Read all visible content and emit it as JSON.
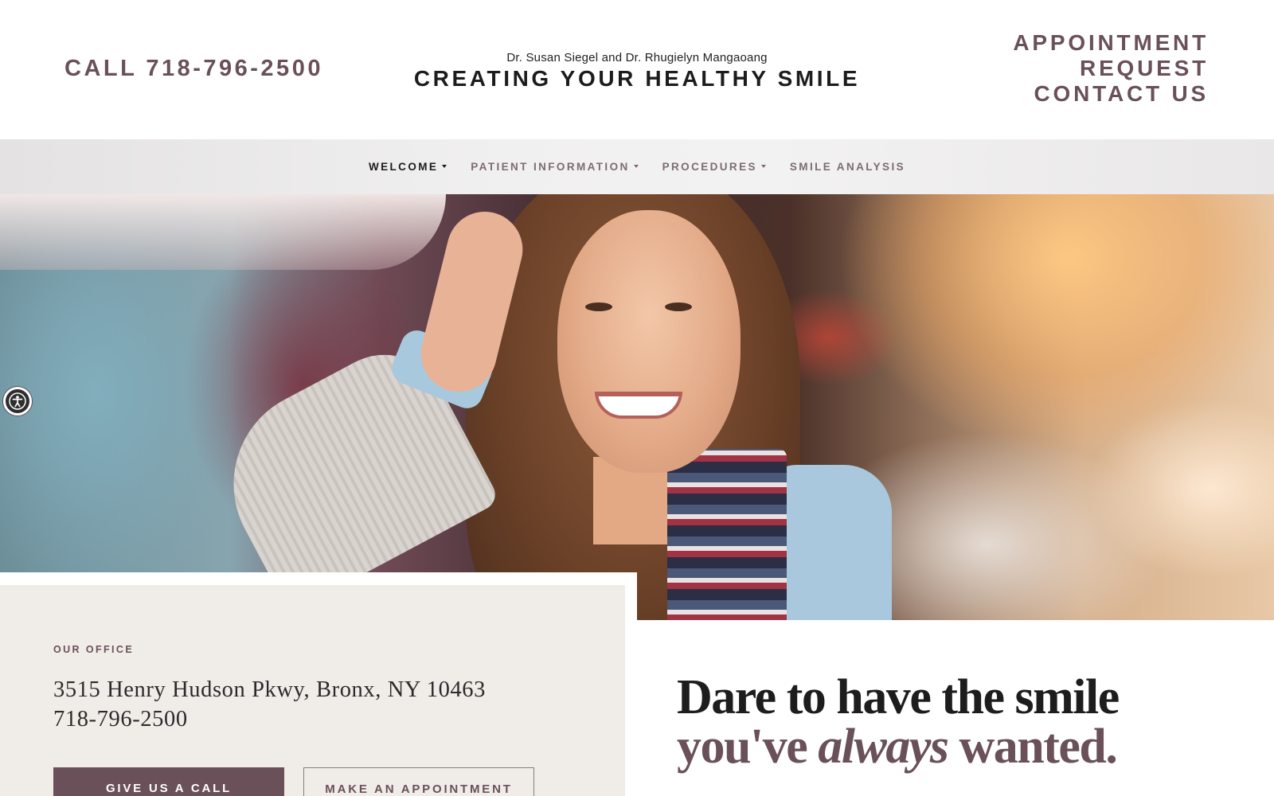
{
  "header": {
    "call_text": "CALL 718-796-2500",
    "doctors": "Dr. Susan Siegel and Dr. Rhugielyn Mangaoang",
    "tagline": "CREATING YOUR HEALTHY SMILE",
    "links": {
      "appointment": "APPOINTMENT",
      "request": "REQUEST",
      "contact": "CONTACT US"
    }
  },
  "nav": {
    "items": [
      {
        "label": "WELCOME",
        "has_dropdown": true,
        "active": true
      },
      {
        "label": "PATIENT INFORMATION",
        "has_dropdown": true,
        "active": false
      },
      {
        "label": "PROCEDURES",
        "has_dropdown": true,
        "active": false
      },
      {
        "label": "SMILE ANALYSIS",
        "has_dropdown": false,
        "active": false
      }
    ]
  },
  "hero": {
    "image_subject": "smiling woman in knit sweater and patterned scarf",
    "accessibility_icon": "accessibility-icon"
  },
  "office": {
    "label": "OUR OFFICE",
    "address": "3515 Henry Hudson Pkwy, Bronx, NY 10463",
    "phone": "718-796-2500",
    "buttons": {
      "call": "GIVE US A CALL",
      "appointment": "MAKE AN APPOINTMENT"
    }
  },
  "headline": {
    "line1": "Dare to have the smile",
    "line2_start": "you've ",
    "line2_emphasis": "always",
    "line2_end": " wanted."
  },
  "colors": {
    "brand": "#6a5059",
    "office_bg": "#f0ece8",
    "text_dark": "#1d1d1d"
  }
}
